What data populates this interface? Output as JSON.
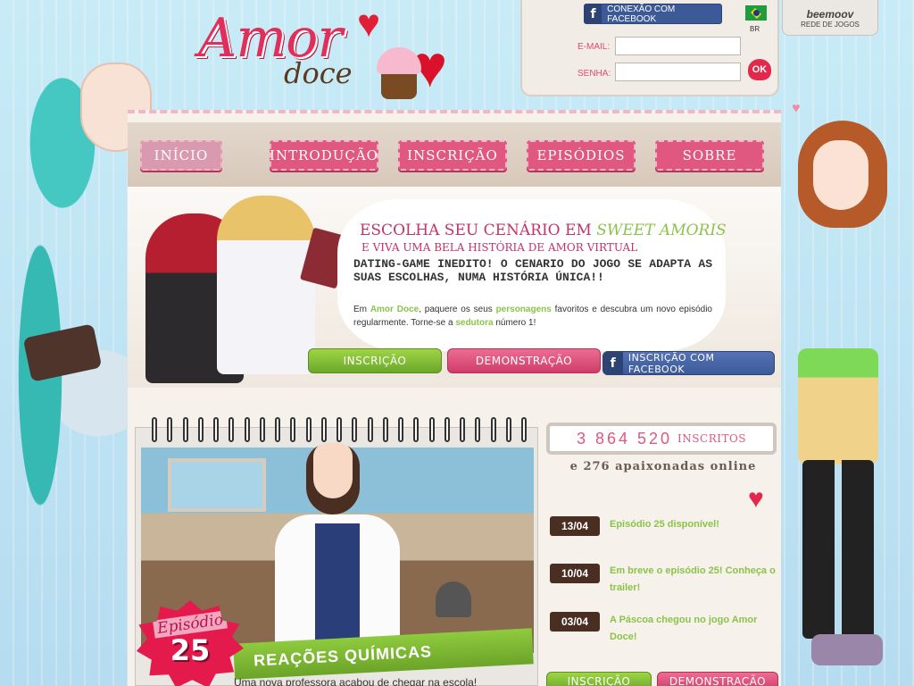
{
  "header": {
    "logo_text": "Amor",
    "logo_sub": "doce",
    "facebook_connect": "CONEXÃO COM FACEBOOK",
    "country": "BR",
    "email_label": "E-MAIL:",
    "password_label": "SENHA:",
    "email_value": "",
    "password_value": "",
    "ok_label": "OK",
    "network_brand": "beemoov",
    "network_label": "REDE DE JOGOS"
  },
  "nav": {
    "items": [
      {
        "label": "INÍCIO"
      },
      {
        "label": "INTRODUÇÃO"
      },
      {
        "label": "INSCRIÇÃO"
      },
      {
        "label": "EPISÓDIOS"
      },
      {
        "label": "SOBRE"
      }
    ]
  },
  "hero": {
    "title_prefix": "ESCOLHA SEU CENÁRIO EM",
    "title_highlight": "SWEET AMORIS",
    "subtitle": "E VIVA UMA BELA HISTÓRIA DE AMOR VIRTUAL",
    "headline": "DATING-GAME INEDITO! O CENARIO DO JOGO SE ADAPTA AS SUAS ESCOLHAS, NUMA HISTÓRIA ÚNICA!!",
    "desc_1": "Em ",
    "desc_brand": "Amor Doce",
    "desc_2": ", paquere os seus ",
    "desc_characters": "personagens",
    "desc_3": " favoritos e descubra um novo episódio regularmente. Torne-se a ",
    "desc_seducer": "sedutora",
    "desc_4": " número 1!",
    "btn_signup": "INSCRIÇÃO",
    "btn_demo": "DEMONSTRAÇÃO",
    "btn_facebook": "INSCRIÇÃO COM FACEBOOK"
  },
  "episode": {
    "label": "Episódio",
    "number": "25",
    "title": "REAÇÕES QUÍMICAS",
    "teaser": "Uma nova professora acabou de chegar na escola!"
  },
  "stats": {
    "subscribers": "3 864 520",
    "subscribers_label": "INSCRITOS",
    "online": "e 276 apaixonadas online"
  },
  "news": [
    {
      "date": "13/04",
      "text": "Episódio 25 disponível!"
    },
    {
      "date": "10/04",
      "text": "Em breve o episódio 25! Conheça o trailer!"
    },
    {
      "date": "03/04",
      "text": "A Páscoa chegou no jogo Amor Doce!"
    }
  ],
  "footer_buttons": {
    "signup": "INSCRIÇÃO",
    "demo": "DEMONSTRAÇÃO"
  },
  "colors": {
    "accent_pink": "#e0577f",
    "accent_green": "#8bc34a",
    "facebook_blue": "#3d5a98",
    "date_brown": "#4a2e22"
  }
}
